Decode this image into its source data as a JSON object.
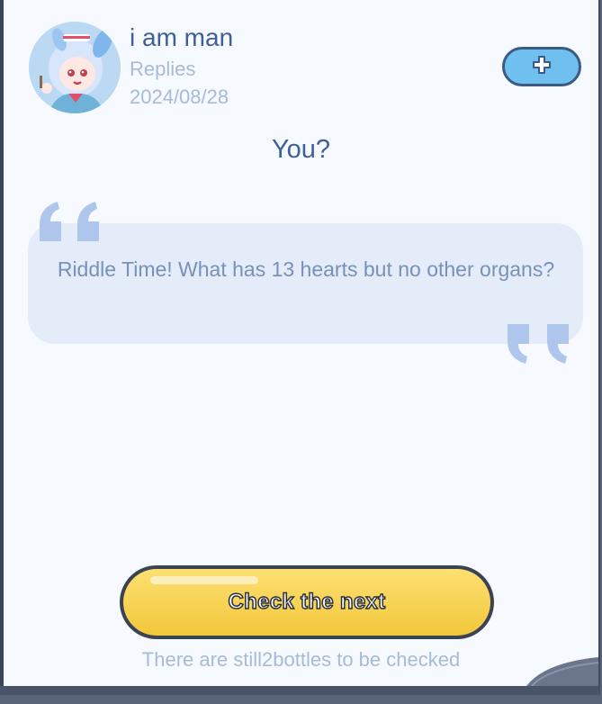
{
  "post": {
    "username": "i am man",
    "label": "Replies",
    "date": "2024/08/28",
    "question": "You?",
    "message": "Riddle Time! What has 13 hearts but no other organs?"
  },
  "actions": {
    "add_icon": "plus-icon",
    "next_label": "Check the next",
    "remaining_text": "There are still2bottles to be checked"
  },
  "colors": {
    "accent_blue": "#6fc0ef",
    "title_blue": "#3f5f9a",
    "muted_text": "#a7bbd6",
    "bubble_bg": "#e3ecf8",
    "button_yellow": "#f7d154"
  }
}
